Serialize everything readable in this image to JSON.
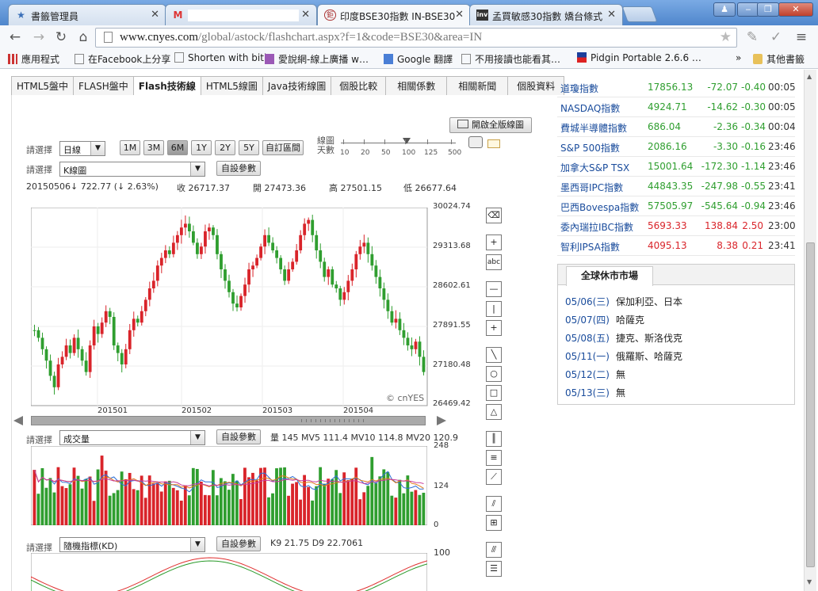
{
  "tabs": [
    {
      "title": "書籤管理員",
      "icon": "★"
    },
    {
      "title": "",
      "icon": "M"
    },
    {
      "title": "印度BSE30指數  IN-BSE30",
      "icon": "鉅"
    },
    {
      "title": "孟買敏感30指數 嬌台條式",
      "icon": "inv"
    }
  ],
  "window_controls": {
    "user": "♟",
    "minimize": "‒",
    "maximize": "❐",
    "close": "✕"
  },
  "url": {
    "host": "www.cnyes.com",
    "path": "/global/astock/flashchart.aspx?f=1&code=BSE30&area=IN"
  },
  "bookmarks": [
    {
      "label": "應用程式"
    },
    {
      "label": "在Facebook上分享"
    },
    {
      "label": "Shorten with bitly"
    },
    {
      "label": "愛說網-線上廣播 w…"
    },
    {
      "label": "Google 翻譯"
    },
    {
      "label": "不用接讀也能看其…"
    },
    {
      "label": "Pidgin Portable 2.6.6 …"
    },
    {
      "label": "»"
    },
    {
      "label": "其他書籤"
    }
  ],
  "page_tabs": [
    "HTML5盤中",
    "FLASH盤中",
    "Flash技術線",
    "HTML5線圖",
    "Java技術線圖",
    "個股比較",
    "相關係數",
    "相關新聞",
    "個股資料"
  ],
  "chart": {
    "fullscreen_label": "開啟全版線圖",
    "select_label": "請選擇",
    "period": "日線",
    "ranges": [
      "1M",
      "3M",
      "6M",
      "1Y",
      "2Y",
      "5Y",
      "自訂區間"
    ],
    "active_range": "6M",
    "days_label": "線圖天數",
    "days_ticks": [
      "10",
      "20",
      "50",
      "100",
      "125",
      "500"
    ],
    "chart_type": "K線圖",
    "param_button": "自設參數",
    "quote": {
      "date": "20150506",
      "change": "↓ 722.77 (↓ 2.63%)",
      "close": "收 26717.37",
      "open": "開 27473.36",
      "high": "高 27501.15",
      "low": "低 26677.64"
    },
    "price_ticks": [
      "30024.74",
      "29313.68",
      "28602.61",
      "27891.55",
      "27180.48",
      "26469.42"
    ],
    "months": [
      "201501",
      "201502",
      "201503",
      "201504"
    ],
    "watermark": "© cnYES",
    "volume_select": "成交量",
    "volume_info": "量 145  MV5 111.4  MV10 114.8  MV20 120.9",
    "volume_ticks": [
      "248",
      "124",
      "0"
    ],
    "kd_select": "隨機指標(KD)",
    "kd_info": "K9 21.75   D9 22.7061",
    "kd_ticks": [
      "100"
    ]
  },
  "indices": [
    {
      "name": "道瓊指數",
      "value": "17856.13",
      "change": "-72.07",
      "pct": "-0.40",
      "time": "00:05"
    },
    {
      "name": "NASDAQ指數",
      "value": "4924.71",
      "change": "-14.62",
      "pct": "-0.30",
      "time": "00:05"
    },
    {
      "name": "費城半導體指數",
      "value": "686.04",
      "change": "-2.36",
      "pct": "-0.34",
      "time": "00:04"
    },
    {
      "name": "S&P 500指數",
      "value": "2086.16",
      "change": "-3.30",
      "pct": "-0.16",
      "time": "23:46"
    },
    {
      "name": "加拿大S&P TSX",
      "value": "15001.64",
      "change": "-172.30",
      "pct": "-1.14",
      "time": "23:46"
    },
    {
      "name": "墨西哥IPC指數",
      "value": "44843.35",
      "change": "-247.98",
      "pct": "-0.55",
      "time": "23:41"
    },
    {
      "name": "巴西Bovespa指數",
      "value": "57505.97",
      "change": "-545.64",
      "pct": "-0.94",
      "time": "23:46"
    },
    {
      "name": "委內瑞拉IBC指數",
      "value": "5693.33",
      "change": "138.84",
      "pct": "2.50",
      "time": "23:00"
    },
    {
      "name": "智利IPSA指數",
      "value": "4095.13",
      "change": "8.38",
      "pct": "0.21",
      "time": "23:41"
    }
  ],
  "holiday": {
    "title": "全球休市市場",
    "rows": [
      {
        "date": "05/06(三)",
        "market": "保加利亞、日本"
      },
      {
        "date": "05/07(四)",
        "market": "哈薩克"
      },
      {
        "date": "05/08(五)",
        "market": "捷克、斯洛伐克"
      },
      {
        "date": "05/11(一)",
        "market": "俄羅斯、哈薩克"
      },
      {
        "date": "05/12(二)",
        "market": "無"
      },
      {
        "date": "05/13(三)",
        "market": "無"
      }
    ]
  },
  "colors": {
    "up": "#d9242a",
    "down": "#2f9e2f",
    "link": "#1a4c9c"
  }
}
